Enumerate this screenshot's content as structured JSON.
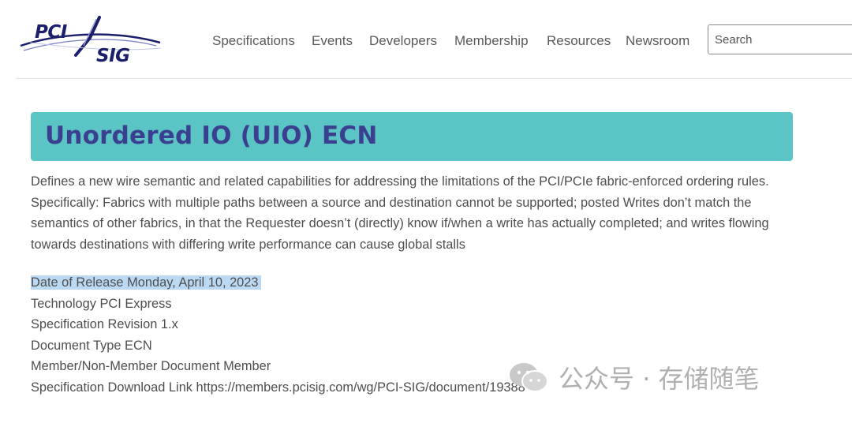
{
  "header": {
    "logo_alt": "PCI SIG",
    "nav": [
      "Specifications",
      "Events",
      "Developers",
      "Membership",
      "Resources",
      "Newsroom"
    ],
    "search_placeholder": "Search"
  },
  "main": {
    "title": "Unordered IO (UIO) ECN",
    "description": [
      "Defines a new wire semantic and related capabilities for addressing the limitations of the PCI/PCIe fabric-enforced ordering rules.",
      "Specifically:  Fabrics with multiple paths between a source and destination cannot be supported; posted Writes don’t match the",
      "semantics of other fabrics, in that the Requester doesn’t (directly) know if/when a write has actually completed; and writes flowing",
      "towards destinations with differing write performance can cause global stalls"
    ],
    "details": [
      "Date of Release Monday, April 10, 2023",
      "Technology PCI Express",
      "Specification Revision 1.x",
      "Document Type ECN",
      "Member/Non-Member Document Member",
      "Specification Download Link https://members.pcisig.com/wg/PCI-SIG/document/19388"
    ]
  },
  "watermark": {
    "text": "公众号 · 存储随笔",
    "icon": "wechat-icon"
  },
  "colors": {
    "banner_bg": "#5bc4c4",
    "title_text": "#3b3f8f",
    "highlight": "#bcd9f4",
    "logo_blue": "#1b1f6b"
  }
}
